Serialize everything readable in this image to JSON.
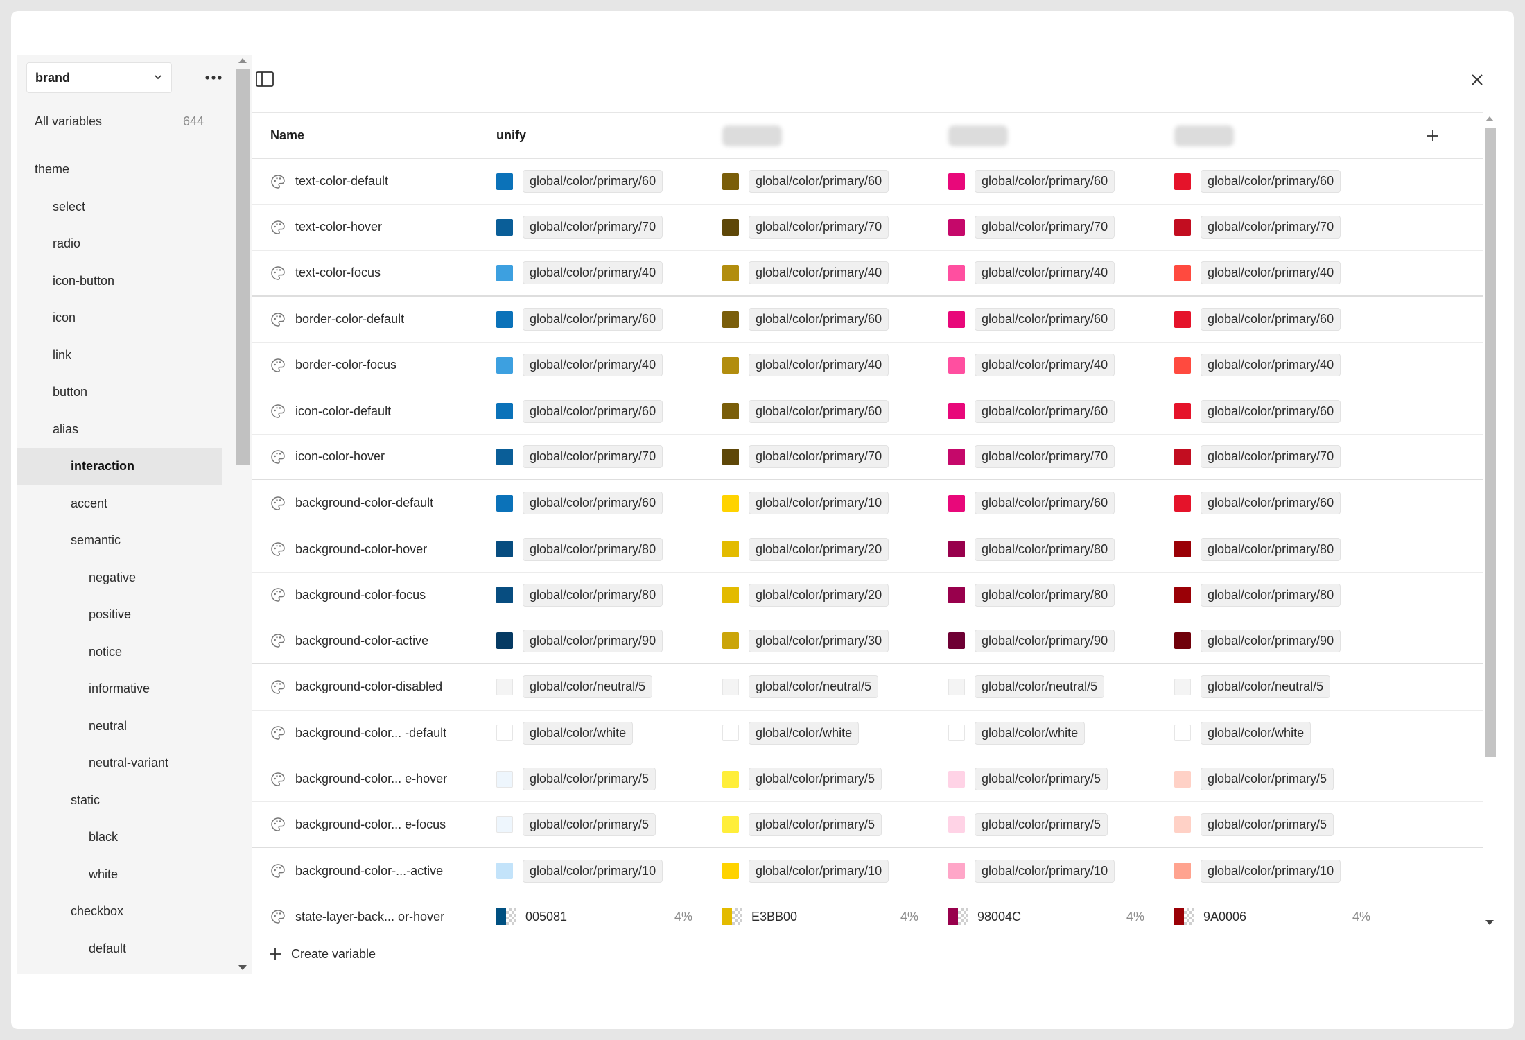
{
  "sidebar": {
    "collection": "brand",
    "all_variables_label": "All variables",
    "all_variables_count": "644",
    "groups": [
      {
        "label": "theme",
        "level": 0,
        "selected": false
      },
      {
        "label": "select",
        "level": 1,
        "selected": false
      },
      {
        "label": "radio",
        "level": 1,
        "selected": false
      },
      {
        "label": "icon-button",
        "level": 1,
        "selected": false
      },
      {
        "label": "icon",
        "level": 1,
        "selected": false
      },
      {
        "label": "link",
        "level": 1,
        "selected": false
      },
      {
        "label": "button",
        "level": 1,
        "selected": false
      },
      {
        "label": "alias",
        "level": 1,
        "selected": false
      },
      {
        "label": "interaction",
        "level": 2,
        "selected": true
      },
      {
        "label": "accent",
        "level": 2,
        "selected": false
      },
      {
        "label": "semantic",
        "level": 2,
        "selected": false
      },
      {
        "label": "negative",
        "level": 3,
        "selected": false
      },
      {
        "label": "positive",
        "level": 3,
        "selected": false
      },
      {
        "label": "notice",
        "level": 3,
        "selected": false
      },
      {
        "label": "informative",
        "level": 3,
        "selected": false
      },
      {
        "label": "neutral",
        "level": 3,
        "selected": false
      },
      {
        "label": "neutral-variant",
        "level": 3,
        "selected": false
      },
      {
        "label": "static",
        "level": 2,
        "selected": false
      },
      {
        "label": "black",
        "level": 3,
        "selected": false
      },
      {
        "label": "white",
        "level": 3,
        "selected": false
      },
      {
        "label": "checkbox",
        "level": 2,
        "selected": false
      },
      {
        "label": "default",
        "level": 3,
        "selected": false
      }
    ]
  },
  "table": {
    "name_header": "Name",
    "mode_headers": [
      "unify",
      "",
      "",
      ""
    ],
    "rows": [
      {
        "name": "text-color-default",
        "group_end": false,
        "cells": [
          {
            "color": "#0B72B9",
            "value": "global/color/primary/60"
          },
          {
            "color": "#7A5E0A",
            "value": "global/color/primary/60"
          },
          {
            "color": "#E8087A",
            "value": "global/color/primary/60"
          },
          {
            "color": "#E5132A",
            "value": "global/color/primary/60"
          }
        ]
      },
      {
        "name": "text-color-hover",
        "group_end": false,
        "cells": [
          {
            "color": "#0A5E98",
            "value": "global/color/primary/70"
          },
          {
            "color": "#5E4708",
            "value": "global/color/primary/70"
          },
          {
            "color": "#C5086A",
            "value": "global/color/primary/70"
          },
          {
            "color": "#C20D20",
            "value": "global/color/primary/70"
          }
        ]
      },
      {
        "name": "text-color-focus",
        "group_end": true,
        "cells": [
          {
            "color": "#3DA0E0",
            "value": "global/color/primary/40"
          },
          {
            "color": "#B28D0E",
            "value": "global/color/primary/40"
          },
          {
            "color": "#FF4FA0",
            "value": "global/color/primary/40"
          },
          {
            "color": "#FF4A3F",
            "value": "global/color/primary/40"
          }
        ]
      },
      {
        "name": "border-color-default",
        "group_end": false,
        "cells": [
          {
            "color": "#0B72B9",
            "value": "global/color/primary/60"
          },
          {
            "color": "#7A5E0A",
            "value": "global/color/primary/60"
          },
          {
            "color": "#E8087A",
            "value": "global/color/primary/60"
          },
          {
            "color": "#E5132A",
            "value": "global/color/primary/60"
          }
        ]
      },
      {
        "name": "border-color-focus",
        "group_end": false,
        "cells": [
          {
            "color": "#3DA0E0",
            "value": "global/color/primary/40"
          },
          {
            "color": "#B28D0E",
            "value": "global/color/primary/40"
          },
          {
            "color": "#FF4FA0",
            "value": "global/color/primary/40"
          },
          {
            "color": "#FF4A3F",
            "value": "global/color/primary/40"
          }
        ]
      },
      {
        "name": "icon-color-default",
        "group_end": false,
        "cells": [
          {
            "color": "#0B72B9",
            "value": "global/color/primary/60"
          },
          {
            "color": "#7A5E0A",
            "value": "global/color/primary/60"
          },
          {
            "color": "#E8087A",
            "value": "global/color/primary/60"
          },
          {
            "color": "#E5132A",
            "value": "global/color/primary/60"
          }
        ]
      },
      {
        "name": "icon-color-hover",
        "group_end": true,
        "cells": [
          {
            "color": "#0A5E98",
            "value": "global/color/primary/70"
          },
          {
            "color": "#5E4708",
            "value": "global/color/primary/70"
          },
          {
            "color": "#C5086A",
            "value": "global/color/primary/70"
          },
          {
            "color": "#C20D20",
            "value": "global/color/primary/70"
          }
        ]
      },
      {
        "name": "background-color-default",
        "group_end": false,
        "cells": [
          {
            "color": "#0B72B9",
            "value": "global/color/primary/60"
          },
          {
            "color": "#FFD300",
            "value": "global/color/primary/10"
          },
          {
            "color": "#E8087A",
            "value": "global/color/primary/60"
          },
          {
            "color": "#E5132A",
            "value": "global/color/primary/60"
          }
        ]
      },
      {
        "name": "background-color-hover",
        "group_end": false,
        "cells": [
          {
            "color": "#074D80",
            "value": "global/color/primary/80"
          },
          {
            "color": "#E3BB00",
            "value": "global/color/primary/20"
          },
          {
            "color": "#98004C",
            "value": "global/color/primary/80"
          },
          {
            "color": "#9A0006",
            "value": "global/color/primary/80"
          }
        ]
      },
      {
        "name": "background-color-focus",
        "group_end": false,
        "cells": [
          {
            "color": "#074D80",
            "value": "global/color/primary/80"
          },
          {
            "color": "#E3BB00",
            "value": "global/color/primary/20"
          },
          {
            "color": "#98004C",
            "value": "global/color/primary/80"
          },
          {
            "color": "#9A0006",
            "value": "global/color/primary/80"
          }
        ]
      },
      {
        "name": "background-color-active",
        "group_end": true,
        "cells": [
          {
            "color": "#053A63",
            "value": "global/color/primary/90"
          },
          {
            "color": "#CBA50A",
            "value": "global/color/primary/30"
          },
          {
            "color": "#6E0034",
            "value": "global/color/primary/90"
          },
          {
            "color": "#70000A",
            "value": "global/color/primary/90"
          }
        ]
      },
      {
        "name": "background-color-disabled",
        "group_end": false,
        "cells": [
          {
            "color": "#F4F4F4",
            "value": "global/color/neutral/5"
          },
          {
            "color": "#F4F4F4",
            "value": "global/color/neutral/5"
          },
          {
            "color": "#F4F4F4",
            "value": "global/color/neutral/5"
          },
          {
            "color": "#F4F4F4",
            "value": "global/color/neutral/5"
          }
        ]
      },
      {
        "name": "background-color... -default",
        "group_end": false,
        "cells": [
          {
            "color": "#FFFFFF",
            "value": "global/color/white"
          },
          {
            "color": "#FFFFFF",
            "value": "global/color/white"
          },
          {
            "color": "#FFFFFF",
            "value": "global/color/white"
          },
          {
            "color": "#FFFFFF",
            "value": "global/color/white"
          }
        ]
      },
      {
        "name": "background-color... e-hover",
        "group_end": false,
        "cells": [
          {
            "color": "#EEF6FD",
            "value": "global/color/primary/5"
          },
          {
            "color": "#FFEE3A",
            "value": "global/color/primary/5"
          },
          {
            "color": "#FFD3E6",
            "value": "global/color/primary/5"
          },
          {
            "color": "#FFD1C6",
            "value": "global/color/primary/5"
          }
        ]
      },
      {
        "name": "background-color... e-focus",
        "group_end": true,
        "cells": [
          {
            "color": "#EEF6FD",
            "value": "global/color/primary/5"
          },
          {
            "color": "#FFEE3A",
            "value": "global/color/primary/5"
          },
          {
            "color": "#FFD3E6",
            "value": "global/color/primary/5"
          },
          {
            "color": "#FFD1C6",
            "value": "global/color/primary/5"
          }
        ]
      },
      {
        "name": "background-color-...-active",
        "group_end": false,
        "cells": [
          {
            "color": "#C3E3FA",
            "value": "global/color/primary/10"
          },
          {
            "color": "#FFD300",
            "value": "global/color/primary/10"
          },
          {
            "color": "#FFA6C8",
            "value": "global/color/primary/10"
          },
          {
            "color": "#FFA38F",
            "value": "global/color/primary/10"
          }
        ]
      }
    ],
    "alpha_row": {
      "name": "state-layer-back... or-hover",
      "cells": [
        {
          "color": "#005081",
          "hex": "005081",
          "opacity": "4%"
        },
        {
          "color": "#E3BB00",
          "hex": "E3BB00",
          "opacity": "4%"
        },
        {
          "color": "#98004C",
          "hex": "98004C",
          "opacity": "4%"
        },
        {
          "color": "#9A0006",
          "hex": "9A0006",
          "opacity": "4%"
        }
      ]
    }
  },
  "footer": {
    "create_label": "Create variable"
  }
}
